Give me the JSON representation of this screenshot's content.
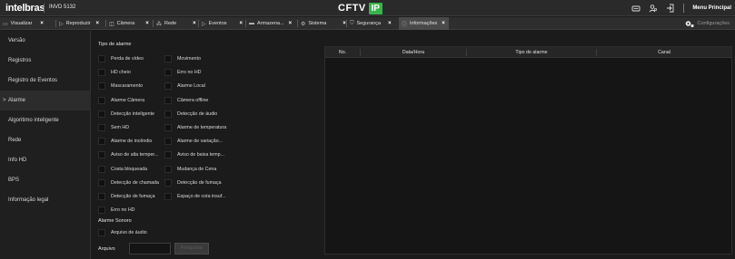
{
  "header": {
    "logo": "intelbras",
    "device": "INVD 5132",
    "brand_text": "CFTV",
    "brand_mark": "IP",
    "icons": [
      "storage-icon",
      "users-icon",
      "logout-icon"
    ],
    "menu_label": "Menu Principal"
  },
  "tabs": [
    {
      "icon": "display-icon",
      "label": "Visualizar",
      "close": "×",
      "active": false
    },
    {
      "icon": "playback-icon",
      "label": "Reproduzir",
      "close": "×",
      "active": false
    },
    {
      "icon": "camera-icon",
      "label": "Câmera",
      "close": "×",
      "active": false
    },
    {
      "icon": "network-icon",
      "label": "Rede",
      "close": "×",
      "active": false
    },
    {
      "icon": "events-icon",
      "label": "Eventos",
      "close": "×",
      "active": false
    },
    {
      "icon": "hdd-icon",
      "label": "Armazena...",
      "close": "×",
      "active": false
    },
    {
      "icon": "system-icon",
      "label": "Sistema",
      "close": "×",
      "active": false
    },
    {
      "icon": "shield-icon",
      "label": "Segurança",
      "close": "×",
      "active": false
    },
    {
      "icon": "info-icon",
      "label": "Informações",
      "close": "×",
      "active": true
    }
  ],
  "config_label": "Configurações",
  "sidebar": {
    "items": [
      {
        "label": "Versão",
        "active": false
      },
      {
        "label": "Registros",
        "active": false
      },
      {
        "label": "Registro de Eventos",
        "active": false
      },
      {
        "label": "Alarme",
        "active": true,
        "arrow": ">"
      },
      {
        "label": "Algoritimo inteligente",
        "active": false
      },
      {
        "label": "Rede",
        "active": false
      },
      {
        "label": "Info HD",
        "active": false
      },
      {
        "label": "BPS",
        "active": false
      },
      {
        "label": "Informação legal",
        "active": false
      }
    ]
  },
  "filter": {
    "alarm_type_label": "Tipo de alarme",
    "left_options": [
      "Perda de vídeo",
      "HD cheio",
      "Mascaramento",
      "Alarme Câmera",
      "Detecção inteligente",
      "Sem HD",
      "Alarme de incêndio",
      "Aviso de alta temper...",
      "Costa bloqueada",
      "Detecção de chamada",
      "Detecção de fumaça",
      "Erro no HD"
    ],
    "right_options": [
      "Movimento",
      "Erro no HD",
      "Alarme Local",
      "Câmera offline",
      "Detecção de áudio",
      "Alarme de temperatura",
      "Alarme de variação...",
      "Aviso de baixa temp...",
      "Mudança de Cena",
      "Detecção de fumaça",
      "Espaço de cota insuf..."
    ],
    "sound_alarm_label": "Alarme Sonoro",
    "audio_file_option": "Arquivo de áudio",
    "file_label": "Arquivo",
    "file_value": "",
    "search_button": "Pesquisar"
  },
  "table": {
    "columns": [
      "No.",
      "Data/Hora",
      "Tipo de alarme",
      "Canal"
    ],
    "rows": []
  },
  "colors": {
    "accent_green": "#36b44a",
    "background": "#1b1b1b",
    "topbar": "#2a2a2a"
  }
}
